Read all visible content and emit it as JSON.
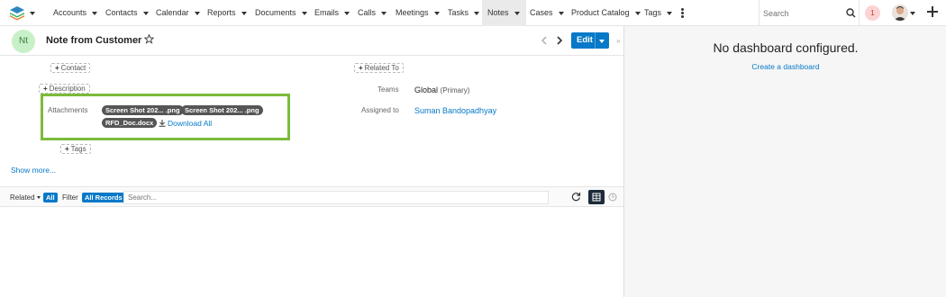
{
  "nav": {
    "items": [
      {
        "label": "Accounts"
      },
      {
        "label": "Contacts"
      },
      {
        "label": "Calendar"
      },
      {
        "label": "Reports"
      },
      {
        "label": "Documents"
      },
      {
        "label": "Emails"
      },
      {
        "label": "Calls"
      },
      {
        "label": "Meetings"
      },
      {
        "label": "Tasks"
      },
      {
        "label": "Notes",
        "active": true
      },
      {
        "label": "Cases"
      },
      {
        "label": "Product Catalog"
      },
      {
        "label": "Tags"
      }
    ],
    "search_placeholder": "Search",
    "notification_count": "1"
  },
  "record": {
    "avatar_text": "Nt",
    "title": "Note from Customer",
    "edit_label": "Edit"
  },
  "fields": {
    "contact_pill": "Contact",
    "related_to_pill": "Related To",
    "description_pill": "Description",
    "teams_label": "Teams",
    "teams_value": "Global",
    "teams_suffix": "(Primary)",
    "attachments_label": "Attachments",
    "attachments": [
      "Screen Shot 202... .png",
      "Screen Shot 202... .png",
      "RFD_Doc.docx"
    ],
    "download_all": "Download All",
    "assigned_label": "Assigned to",
    "assigned_value": "Suman Bandopadhyay",
    "tags_pill": "Tags",
    "show_more": "Show more..."
  },
  "subpanel": {
    "related_label": "Related",
    "related_badge": "All",
    "filter_label": "Filter",
    "filter_badge": "All Records",
    "search_placeholder": "Search..."
  },
  "dashboard": {
    "message": "No dashboard configured.",
    "create_link": "Create a dashboard"
  },
  "colors": {
    "accent": "#0679c8",
    "highlight_border": "#7bbb3a",
    "notification_bg": "#fbd3d3"
  }
}
